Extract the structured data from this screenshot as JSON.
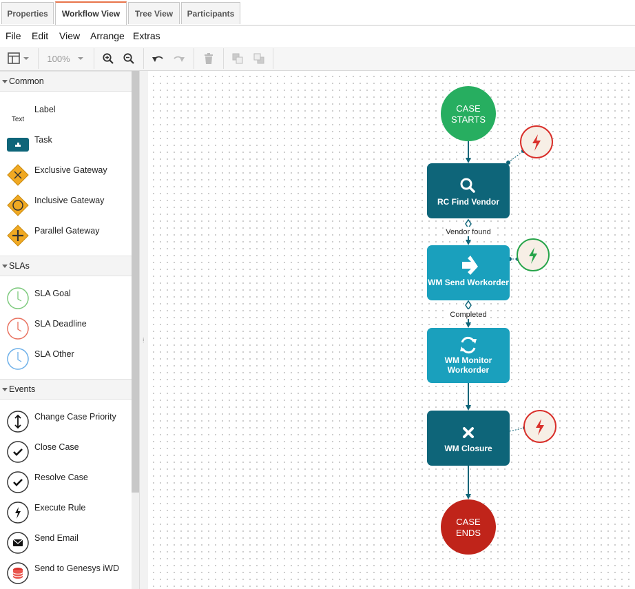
{
  "tabs": [
    {
      "label": "Properties",
      "active": false
    },
    {
      "label": "Workflow View",
      "active": true
    },
    {
      "label": "Tree View",
      "active": false
    },
    {
      "label": "Participants",
      "active": false
    }
  ],
  "menu": [
    "File",
    "Edit",
    "View",
    "Arrange",
    "Extras"
  ],
  "toolbar": {
    "zoom": "100%"
  },
  "sidebar": {
    "common": {
      "title": "Common",
      "items": [
        {
          "label": "Label",
          "icon_text": "Text"
        },
        {
          "label": "Task"
        },
        {
          "label": "Exclusive Gateway"
        },
        {
          "label": "Inclusive Gateway"
        },
        {
          "label": "Parallel Gateway"
        }
      ]
    },
    "slas": {
      "title": "SLAs",
      "items": [
        {
          "label": "SLA Goal",
          "color": "#7cc97c"
        },
        {
          "label": "SLA Deadline",
          "color": "#e8705e"
        },
        {
          "label": "SLA Other",
          "color": "#6aaee8"
        }
      ]
    },
    "events": {
      "title": "Events",
      "items": [
        {
          "label": "Change Case Priority"
        },
        {
          "label": "Close Case"
        },
        {
          "label": "Resolve Case"
        },
        {
          "label": "Execute Rule"
        },
        {
          "label": "Send Email"
        },
        {
          "label": "Send to Genesys iWD"
        }
      ]
    }
  },
  "workflow": {
    "start": {
      "line1": "CASE",
      "line2": "STARTS",
      "color": "#27ae60"
    },
    "end": {
      "line1": "CASE",
      "line2": "ENDS",
      "color": "#c0241a"
    },
    "tasks": [
      {
        "label": "RC Find Vendor",
        "icon": "search-icon",
        "color": "#0e6579"
      },
      {
        "label": "WM Send Workorder",
        "icon": "arrow-right-icon",
        "color": "#1aa0bd"
      },
      {
        "label_line1": "WM Monitor",
        "label_line2": "Workorder",
        "icon": "refresh-icon",
        "color": "#1aa0bd"
      },
      {
        "label": "WM Closure",
        "icon": "close-x-icon",
        "color": "#0e6579"
      }
    ],
    "edge_labels": [
      "Vendor found",
      "Completed"
    ],
    "colors": {
      "edge": "#0e6579",
      "rule_red": "#d9302b",
      "rule_green": "#27a44a",
      "rule_fill": "#f7efe6"
    }
  }
}
